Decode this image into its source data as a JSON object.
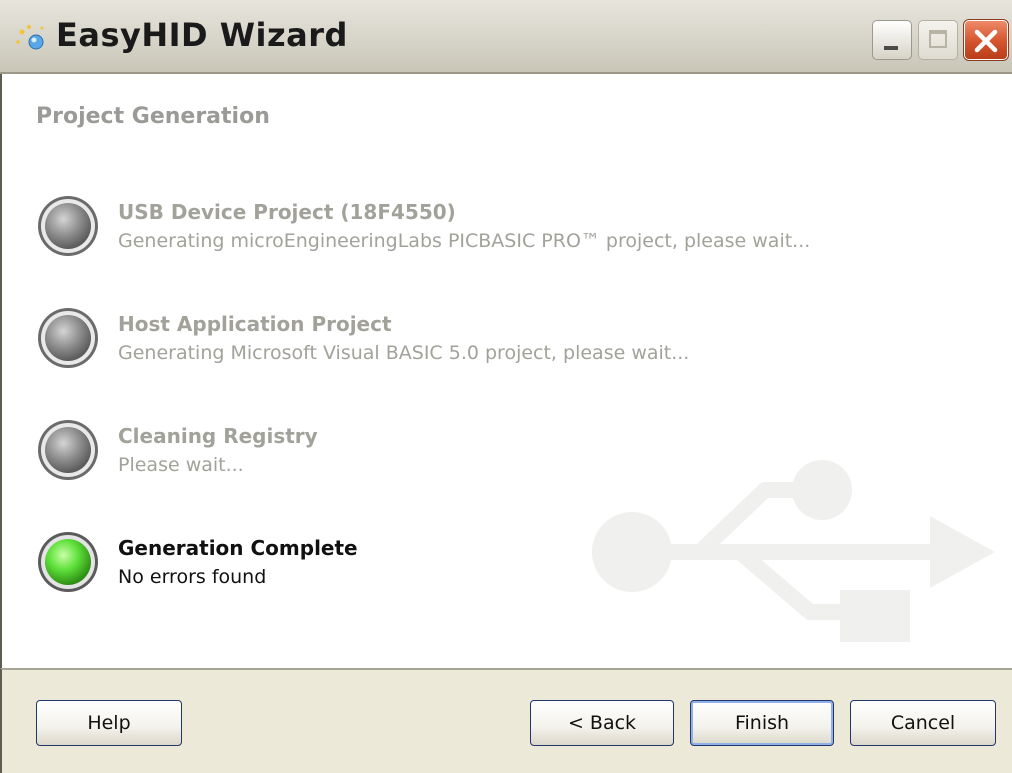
{
  "window": {
    "title": "EasyHID Wizard"
  },
  "page": {
    "heading": "Project Generation"
  },
  "steps": [
    {
      "title": "USB Device Project (18F4550)",
      "description": "Generating microEngineeringLabs PICBASIC PRO™ project, please wait...",
      "state": "pending"
    },
    {
      "title": "Host Application Project",
      "description": "Generating Microsoft Visual BASIC 5.0 project, please wait...",
      "state": "pending"
    },
    {
      "title": "Cleaning Registry",
      "description": "Please wait...",
      "state": "pending"
    },
    {
      "title": "Generation Complete",
      "description": "No errors found",
      "state": "complete"
    }
  ],
  "buttons": {
    "help": "Help",
    "back": "< Back",
    "finish": "Finish",
    "cancel": "Cancel"
  },
  "icons": {
    "app": "sparkle-wizard-icon",
    "pending_led": "gray-led-icon",
    "complete_led": "green-led-icon",
    "watermark": "usb-logo-icon"
  },
  "colors": {
    "inactive_text": "#a2a29b",
    "active_text": "#111111",
    "led_green": "#5ee03a",
    "led_gray": "#8a8a8a",
    "close_button": "#d4532c"
  }
}
